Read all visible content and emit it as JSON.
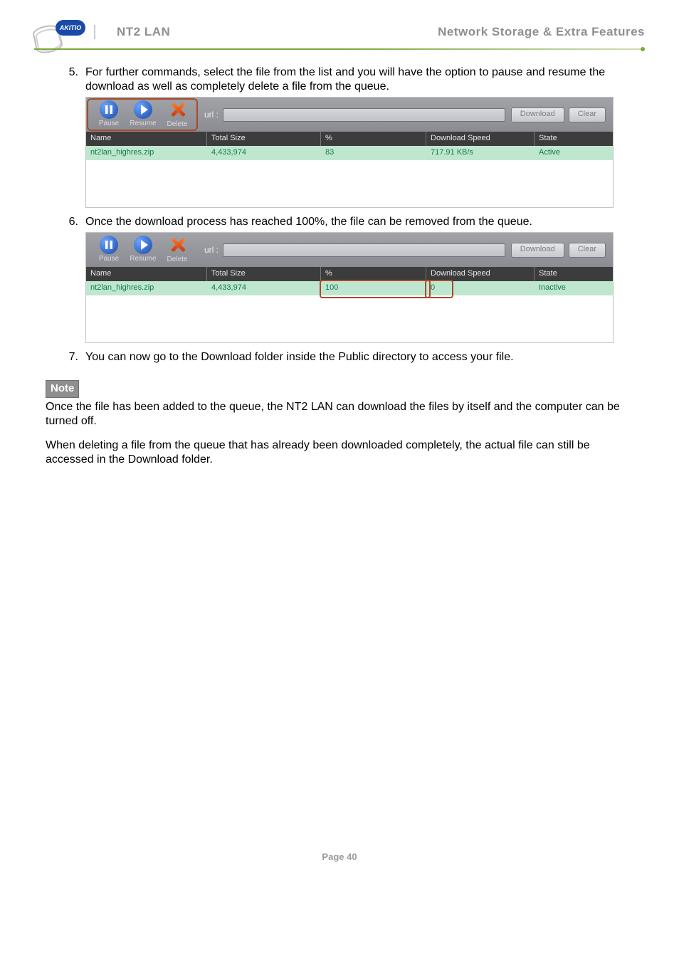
{
  "header": {
    "logo_text": "AKITIO",
    "left_title": "NT2 LAN",
    "right_title": "Network Storage & Extra Features"
  },
  "steps": {
    "s5": {
      "num": "5.",
      "text": "For further commands, select the file from the list and you will have the option to pause and resume the download as well as completely delete a file from the queue."
    },
    "s6": {
      "num": "6.",
      "text": "Once the download process has reached 100%, the file can be removed from the queue."
    },
    "s7": {
      "num": "7.",
      "text": "You can now go to the Download folder inside the Public directory to access your file."
    }
  },
  "toolbar": {
    "pause": "Pause",
    "resume": "Resume",
    "delete": "Delete",
    "url_label": "url :",
    "download_btn": "Download",
    "clear_btn": "Clear"
  },
  "grid": {
    "headers": {
      "name": "Name",
      "size": "Total Size",
      "pct": "%",
      "speed": "Download Speed",
      "state": "State"
    },
    "shot1_row": {
      "name": "nt2lan_highres.zip",
      "size": "4,433,974",
      "pct": "83",
      "speed": "717.91 KB/s",
      "state": "Active"
    },
    "shot2_row": {
      "name": "nt2lan_highres.zip",
      "size": "4,433,974",
      "pct": "100",
      "speed": "0",
      "state": "Inactive"
    }
  },
  "note": {
    "label": "Note",
    "p1": "Once the file has been added to the queue, the NT2 LAN can download the files by itself and the computer can be turned off.",
    "p2": "When deleting a file from the queue that has already been downloaded completely, the actual file can still be accessed in the Download folder."
  },
  "footer": {
    "page": "Page 40"
  }
}
